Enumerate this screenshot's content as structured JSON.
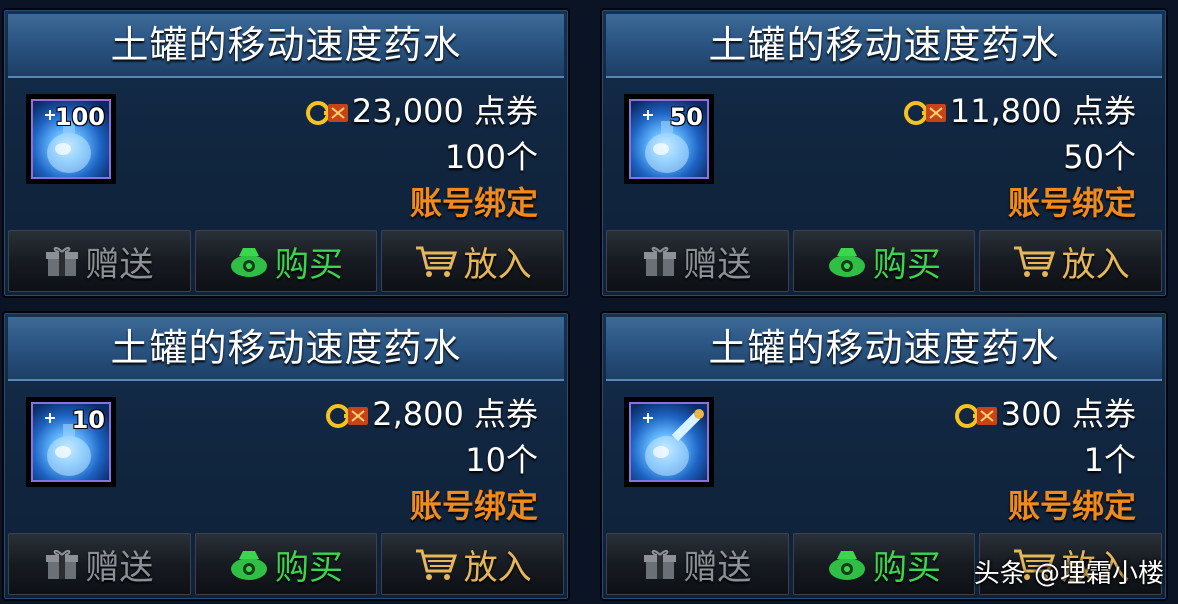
{
  "items": [
    {
      "title": "土罐的移动速度药水",
      "icon_count": "100",
      "price": "23,000",
      "currency_label": "点券",
      "quantity": "100个",
      "bind_label": "账号绑定",
      "buttons": {
        "gift": "赠送",
        "buy": "购买",
        "cart": "放入"
      }
    },
    {
      "title": "土罐的移动速度药水",
      "icon_count": "50",
      "price": "11,800",
      "currency_label": "点券",
      "quantity": "50个",
      "bind_label": "账号绑定",
      "buttons": {
        "gift": "赠送",
        "buy": "购买",
        "cart": "放入"
      }
    },
    {
      "title": "土罐的移动速度药水",
      "icon_count": "10",
      "price": "2,800",
      "currency_label": "点券",
      "quantity": "10个",
      "bind_label": "账号绑定",
      "buttons": {
        "gift": "赠送",
        "buy": "购买",
        "cart": "放入"
      }
    },
    {
      "title": "土罐的移动速度药水",
      "icon_count": "",
      "price": "300",
      "currency_label": "点券",
      "quantity": "1个",
      "bind_label": "账号绑定",
      "buttons": {
        "gift": "赠送",
        "buy": "购买",
        "cart": "放入"
      }
    }
  ],
  "watermark": "头条 @埋霜小楼",
  "icons": {
    "item": "potion-flask-icon",
    "currency": "coupon-icon",
    "gift": "gift-icon",
    "buy": "money-bag-icon",
    "cart": "shopping-cart-icon"
  },
  "colors": {
    "bind_text": "#f08a1c",
    "buy_text": "#39d64e",
    "cart_text": "#e5b75a",
    "gift_text": "#8d9197"
  }
}
